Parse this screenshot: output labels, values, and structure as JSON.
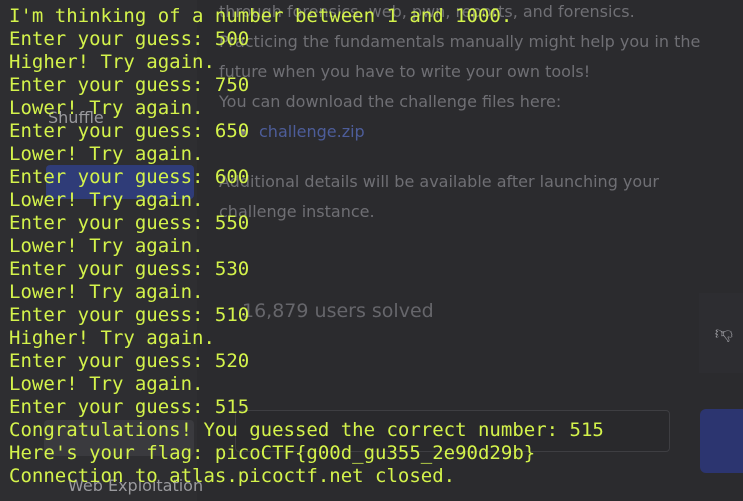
{
  "background": {
    "nav": {
      "items": [
        "Shuffle",
        "Web Exploitation"
      ]
    },
    "description": {
      "line1": "through forensics, web, pwn, reports, and forensics.",
      "line2": "Practicing the fundamentals manually might help you in the",
      "line3": "future when you have to write your own tools!",
      "line4": "You can download the challenge files here:",
      "file_link": "challenge.zip",
      "line5": "Additional details will be available after launching your",
      "line6": "challenge instance."
    },
    "solved_text": "16,879 users solved",
    "dislike_icon": "thumbs-down-icon"
  },
  "terminal": {
    "lines": [
      "I'm thinking of a number between 1 and 1000.",
      "Enter your guess: 500",
      "Higher! Try again.",
      "Enter your guess: 750",
      "Lower! Try again.",
      "Enter your guess: 650",
      "Lower! Try again.",
      "Enter your guess: 600",
      "Lower! Try again.",
      "Enter your guess: 550",
      "Lower! Try again.",
      "Enter your guess: 530",
      "Lower! Try again.",
      "Enter your guess: 510",
      "Higher! Try again.",
      "Enter your guess: 520",
      "Lower! Try again.",
      "Enter your guess: 515",
      "Congratulations! You guessed the correct number: 515",
      "Here's your flag: picoCTF{g00d_gu355_2e90d29b}",
      "Connection to atlas.picoctf.net closed."
    ]
  },
  "colors": {
    "terminal_text": "#d4f34b",
    "background": "#2b2b2e",
    "accent": "#2f3c78"
  }
}
